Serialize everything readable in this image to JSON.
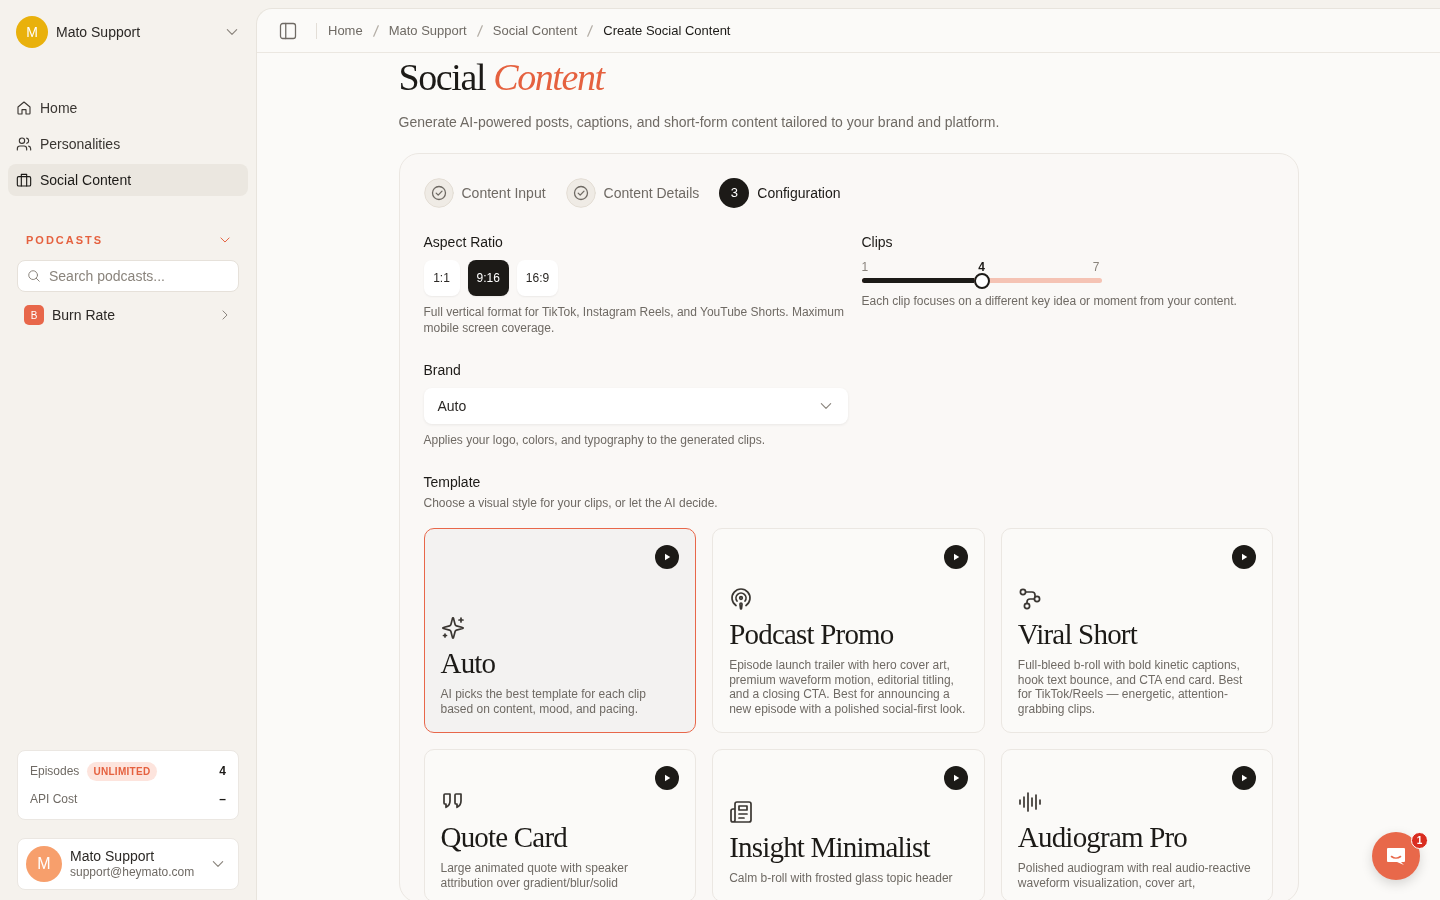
{
  "sidebar": {
    "workspace": {
      "initial": "M",
      "name": "Mato Support"
    },
    "nav": [
      {
        "label": "Home",
        "selected": false
      },
      {
        "label": "Personalities",
        "selected": false
      },
      {
        "label": "Social Content",
        "selected": true
      }
    ],
    "podcasts_section": {
      "title": "PODCASTS",
      "expanded": true,
      "search": {
        "placeholder": "Search podcasts..."
      },
      "items": [
        {
          "initial": "B",
          "name": "Burn Rate"
        }
      ]
    },
    "usage": [
      {
        "label": "Episodes",
        "badge": "UNLIMITED",
        "value": "4"
      },
      {
        "label": "API Cost",
        "value": "–"
      }
    ],
    "user": {
      "initial": "M",
      "name": "Mato Support",
      "email": "support@heymato.com"
    }
  },
  "breadcrumbs": [
    {
      "label": "Home",
      "current": false
    },
    {
      "label": "Mato Support",
      "current": false
    },
    {
      "label": "Social Content",
      "current": false
    },
    {
      "label": "Create Social Content",
      "current": true
    }
  ],
  "page": {
    "title": "Social *Content*",
    "subtitle": "Generate AI-powered posts, captions, and short-form content tailored to your brand and platform."
  },
  "steps": [
    {
      "label": "Content Input",
      "done": true,
      "selected": false
    },
    {
      "label": "Content Details",
      "done": true,
      "selected": false
    },
    {
      "label": "Configuration",
      "number": "3",
      "done": false,
      "selected": true
    }
  ],
  "aspect_ratio": {
    "label": "Aspect Ratio",
    "options": [
      {
        "label": "1:1",
        "selected": false
      },
      {
        "label": "9:16",
        "selected": true
      },
      {
        "label": "16:9",
        "selected": false
      }
    ],
    "hint": "Full vertical format for TikTok, Instagram Reels, and YouTube Shorts. Maximum mobile screen coverage."
  },
  "clips": {
    "label": "Clips",
    "min": "1",
    "max": "7",
    "value": "4",
    "level": 0.5,
    "hint": "Each clip focuses on a different key idea or moment from your content."
  },
  "brand": {
    "label": "Brand",
    "value": "Auto",
    "hint": "Applies your logo, colors, and typography to the generated clips."
  },
  "template": {
    "label": "Template",
    "hint": "Choose a visual style for your clips, or let the AI decide.",
    "cards": [
      {
        "title": "Auto",
        "description": "AI picks the best template for each clip based on content, mood, and pacing.",
        "selected": true
      },
      {
        "title": "Podcast Promo",
        "description": "Episode launch trailer with hero cover art, premium waveform motion, editorial titling, and a closing CTA. Best for announcing a new episode with a polished social-first look.",
        "selected": false
      },
      {
        "title": "Viral Short",
        "description": "Full-bleed b-roll with bold kinetic captions, hook text bounce, and CTA end card. Best for TikTok/Reels — energetic, attention-grabbing clips.",
        "selected": false
      },
      {
        "title": "Quote Card",
        "description": "Large animated quote with speaker attribution over gradient/blur/solid",
        "selected": false
      },
      {
        "title": "Insight Minimalist",
        "description": "Calm b-roll with frosted glass topic header",
        "selected": false
      },
      {
        "title": "Audiogram Pro",
        "description": "Polished audiogram with real audio-reactive waveform visualization, cover art,",
        "selected": false
      }
    ]
  },
  "chat": {
    "unread": "1"
  }
}
